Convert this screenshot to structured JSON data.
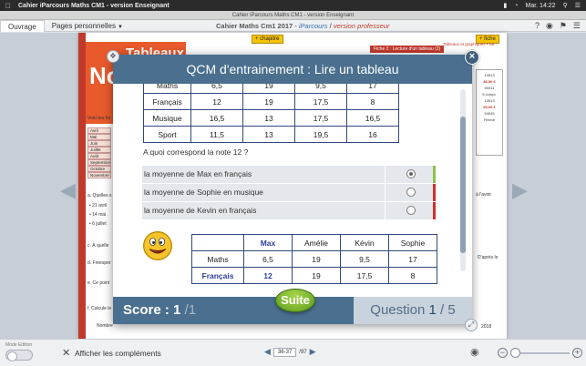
{
  "menubar": {
    "app_name": "Cahier iParcours Maths CM1 - version Enseignant",
    "clock": "Mar. 14:22"
  },
  "window": {
    "title": "Cahier iParcours Maths CM1 - version Enseignant"
  },
  "toolbar": {
    "tabs": [
      "Ouvrage",
      "Pages personnelles"
    ],
    "doc_title_main": "Cahier Maths Cm1 2017",
    "doc_title_sep": " - ",
    "doc_title_ip": "iParcours",
    "doc_title_slash": " / ",
    "doc_title_vp": "version professeur"
  },
  "page": {
    "banner_letters": "No",
    "banner_title": "Tableaux",
    "chapitre_btn": "+ chapitre",
    "fiche_btn": "+ fiche",
    "fiche2": "Fiche 2 : Lecture d'un tableau (2)",
    "fiche_sub": "Tableaux et graphiques • N6",
    "side_box": [
      "13513",
      "86,00 €",
      "00011",
      "5 compt.",
      "13513",
      "69,00 €",
      "94045",
      "Fléche"
    ],
    "voici": "Voici les ho",
    "months": [
      "Avril",
      "Mai",
      "Juin",
      "Juillet",
      "Août",
      "Septembre",
      "Octobre",
      "Novembre"
    ],
    "snippets": [
      "a. Quelles s",
      "• 21 avril",
      "• 14 mai",
      "• 6 juillet",
      "c. À quelle",
      "d. Freesper",
      "e. Ce point",
      "f. Calcule le",
      "Nombre",
      "à l'avoir",
      "2018",
      "D'après lo"
    ]
  },
  "modal": {
    "title": "QCM d'entrainement : Lire un tableau",
    "top_table_rows": [
      [
        "Maths",
        "6,5",
        "19",
        "9,5",
        "17"
      ],
      [
        "Français",
        "12",
        "19",
        "17,5",
        "8"
      ],
      [
        "Musique",
        "16,5",
        "13",
        "17,5",
        "16,5"
      ],
      [
        "Sport",
        "11,5",
        "13",
        "19,5",
        "16"
      ]
    ],
    "question": "A quoi correspond la note 12 ?",
    "answers": [
      {
        "label": "la moyenne de Max en français",
        "selected": true,
        "status_color": "#8bc34a"
      },
      {
        "label": "la moyenne de Sophie en musique",
        "selected": false,
        "status_color": "#d32f2f"
      },
      {
        "label": "la moyenne de Kevin en français",
        "selected": false,
        "status_color": "#d32f2f"
      }
    ],
    "bottom_table": {
      "header": [
        "",
        "Max",
        "Amélie",
        "Kévin",
        "Sophie"
      ],
      "rows": [
        [
          "Maths",
          "6,5",
          "19",
          "9,5",
          "17"
        ],
        [
          "Français",
          "12",
          "19",
          "17,5",
          "8"
        ]
      ]
    },
    "footer": {
      "score_label": "Score : 1",
      "score_denom": "/1",
      "question_label": "Question",
      "question_current": "1",
      "question_total": "/ 5",
      "suite_label": "Suite"
    }
  },
  "bottombar": {
    "mode_edition": "Mode Edition",
    "show_complements": "Afficher les compléments",
    "page_range": "36-37",
    "page_total": "/97"
  },
  "colors": {
    "header_blue": "#4a6f8f",
    "correct": "#8bc34a",
    "wrong": "#d32f2f",
    "suite_green": "#6aac23"
  }
}
